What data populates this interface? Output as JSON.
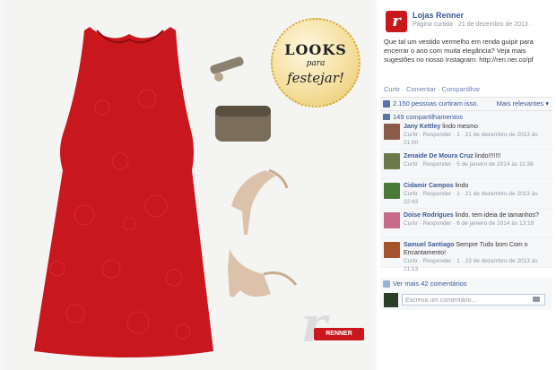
{
  "page": {
    "name": "Lojas Renner",
    "meta": "Página curtida · 21 de dezembro de 2013 · ",
    "avatar_letter": "r"
  },
  "photo": {
    "badge_line1": "LOOKS",
    "badge_line2": "para",
    "badge_line3": "festejar!",
    "watermark": "r",
    "logo_text": "RENNER"
  },
  "post": {
    "text": "Que tal um vestido vermelho em renda guipir para encerrar o ano com muita elegância? Veja mais sugestões no nosso Instagram: http://ren.ner.co/pf",
    "actions": "Curtir · Comentar · Compartilhar"
  },
  "stats": {
    "likes": "2.150 pessoas curtiram isso.",
    "sort": "Mais relevantes ▾",
    "shares": "149 compartilhamentos"
  },
  "comments": [
    {
      "name": "Jany Kettley",
      "text": "lindo mesmo",
      "meta": "Curtir · Responder · 1 · 21 de dezembro de 2013 às 21:00",
      "avatar": "#8a5a4a"
    },
    {
      "name": "Zenaide De Moura Cruz",
      "text": "lindo!!!!!!!",
      "meta": "Curtir · Responder · 5 de janeiro de 2014 às 11:38",
      "avatar": "#6a7a4a"
    },
    {
      "name": "Cidamir Campos",
      "text": "lindo",
      "meta": "Curtir · Responder · 1 · 21 de dezembro de 2013 às 22:43",
      "avatar": "#4a7a3a"
    },
    {
      "name": "Doise Rodrigues",
      "text": "lindo. tem ideia de tamanhos?",
      "meta": "Curtir · Responder · 6 de janeiro de 2014 às 13:18",
      "avatar": "#c86a8a"
    },
    {
      "name": "Samuel Santiago",
      "text": "Sempre Tudo bom Com o Encantamento!",
      "meta": "Curtir · Responder · 1 · 23 de dezembro de 2013 às 21:13",
      "avatar": "#a4542a"
    }
  ],
  "more": "Ver mais 42 comentários",
  "write": {
    "placeholder": "Escreva um comentário..."
  },
  "colors": {
    "dress": "#c8181e",
    "link": "#3b5998",
    "brand": "#c8181e"
  }
}
